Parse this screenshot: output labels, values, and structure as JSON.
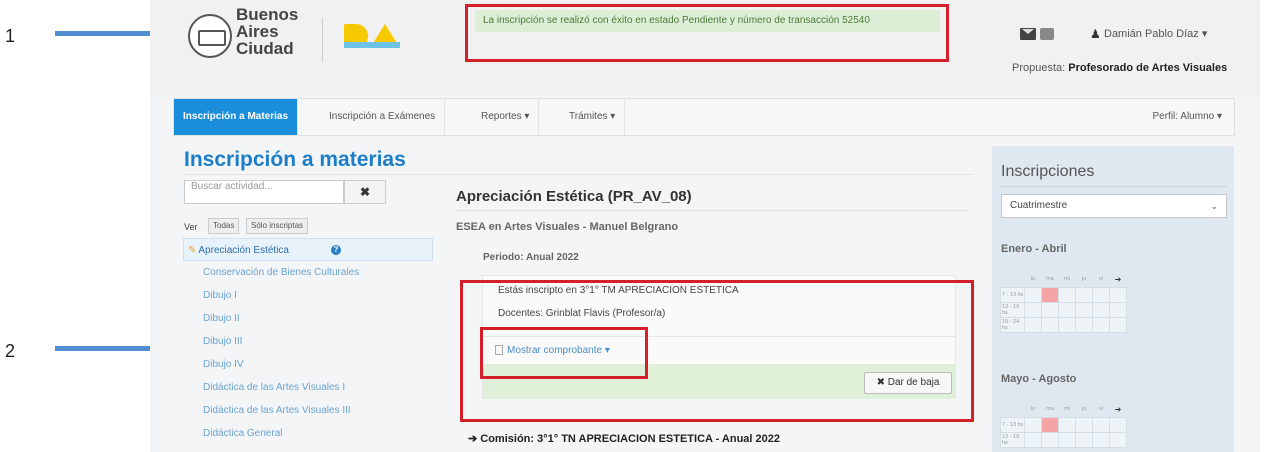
{
  "annotations": {
    "label1": "1",
    "label2": "2"
  },
  "header": {
    "logo_text_lines": [
      "Buenos",
      "Aires",
      "Ciudad"
    ],
    "success_message": "La inscripción se realizó con éxito en estado Pendiente y número de transacción 52540",
    "user_name": "Damián Pablo Díaz ▾",
    "propuesta_label": "Propuesta:",
    "propuesta_value": "Profesorado de Artes Visuales"
  },
  "nav": {
    "items": [
      "Inscripción a Materias",
      "Inscripción a Exámenes",
      "Reportes ▾",
      "Trámites ▾"
    ],
    "perfil": "Perfil: Alumno ▾"
  },
  "left": {
    "page_title": "Inscripción a materias",
    "search_placeholder": "Buscar actividad...",
    "search_clear": "✖",
    "ver_label": "Ver",
    "ver_options": [
      "Todas",
      "Sólo inscriptas"
    ],
    "activities": [
      "Apreciación Estética",
      "Conservación de Bienes Culturales",
      "Dibujo I",
      "Dibujo II",
      "Dibujo III",
      "Dibujo IV",
      "Didáctica de las Artes Visuales I",
      "Didáctica de las Artes Visuales III",
      "Didáctica General"
    ]
  },
  "main": {
    "course_title": "Apreciación Estética (PR_AV_08)",
    "course_sub": "ESEA en Artes Visuales - Manuel Belgrano",
    "periodo": "Periodo: Anual 2022",
    "enrolled_text": "Estás inscripto en 3°1° TM APRECIACION ESTETICA",
    "docentes": "Docentes: Grinblat Flavis (Profesor/a)",
    "mostrar_comprobante": "Mostrar comprobante ▾",
    "baja_label": "✖ Dar de baja",
    "comision": "➔ Comisión: 3°1° TN APRECIACION ESTETICA - Anual 2022"
  },
  "right": {
    "title": "Inscripciones",
    "period_select": "Cuatrimestre",
    "semesters": [
      {
        "title": "Enero - Abril",
        "days": [
          "lu",
          "ma",
          "mi",
          "ju",
          "vi",
          "➔"
        ],
        "slots": [
          "7 - 13 hs",
          "13 - 19 hs",
          "19 - 24 hs"
        ],
        "active": [
          [
            0,
            1
          ]
        ]
      },
      {
        "title": "Mayo - Agosto",
        "days": [
          "lu",
          "ma",
          "mi",
          "ju",
          "vi",
          "➔"
        ],
        "slots": [
          "7 - 13 hs",
          "13 - 19 hs"
        ],
        "active": [
          [
            0,
            1
          ]
        ]
      }
    ]
  },
  "colors": {
    "accent": "#1a8ddb",
    "annotation_red": "#d3202a",
    "arrow_blue": "#4f8fd1",
    "success_green": "#dcefd6"
  }
}
